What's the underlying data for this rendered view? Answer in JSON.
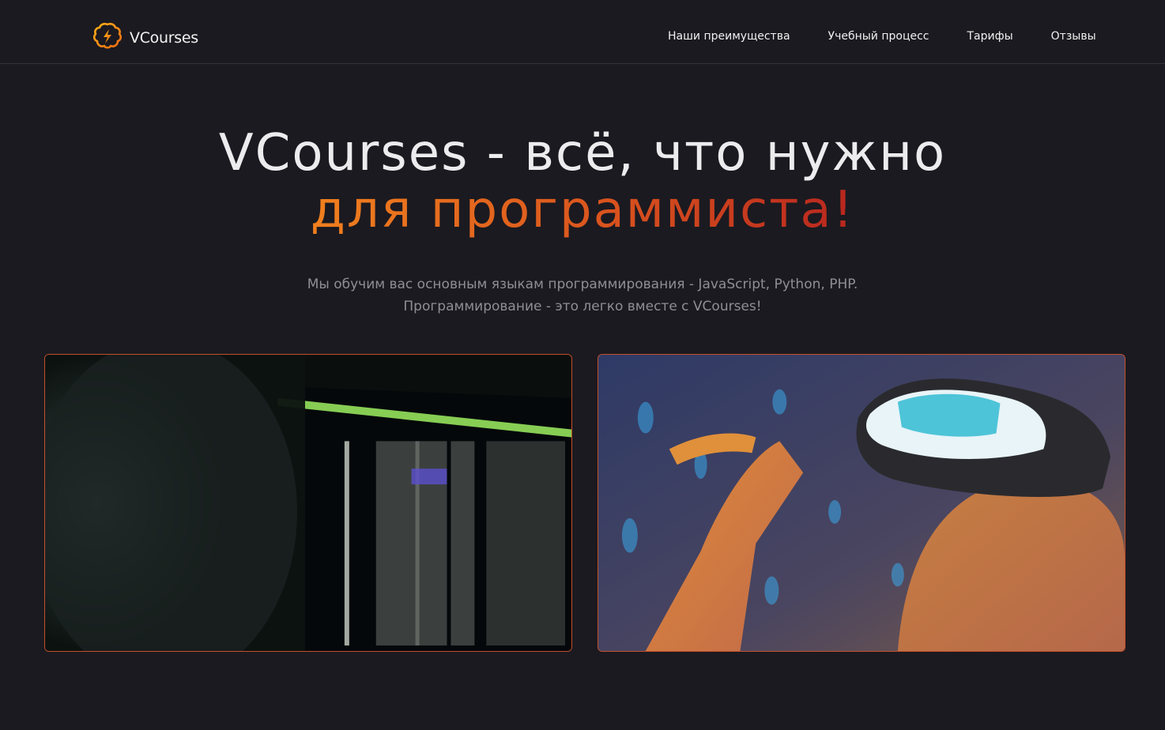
{
  "header": {
    "logo_text": "VCourses",
    "logo_icon": "brain-lightning-icon",
    "nav": [
      {
        "label": "Наши преимущества"
      },
      {
        "label": "Учебный процесс"
      },
      {
        "label": "Тарифы"
      },
      {
        "label": "Отзывы"
      }
    ]
  },
  "hero": {
    "title_line1": "VCourses - всё, что нужно",
    "title_line2": "для программиста!",
    "subtitle_line1": "Мы обучим вас основным языкам программирования - JavaScript, Python, PHP.",
    "subtitle_line2": "Программирование - это легко вместе с VCourses!"
  },
  "images": [
    {
      "name": "terminal-screen-photo"
    },
    {
      "name": "vr-headset-photo"
    }
  ],
  "colors": {
    "background": "#1b1a20",
    "accent_orange": "#f0801e",
    "accent_red": "#b8261f",
    "card_border": "#c4502a"
  }
}
